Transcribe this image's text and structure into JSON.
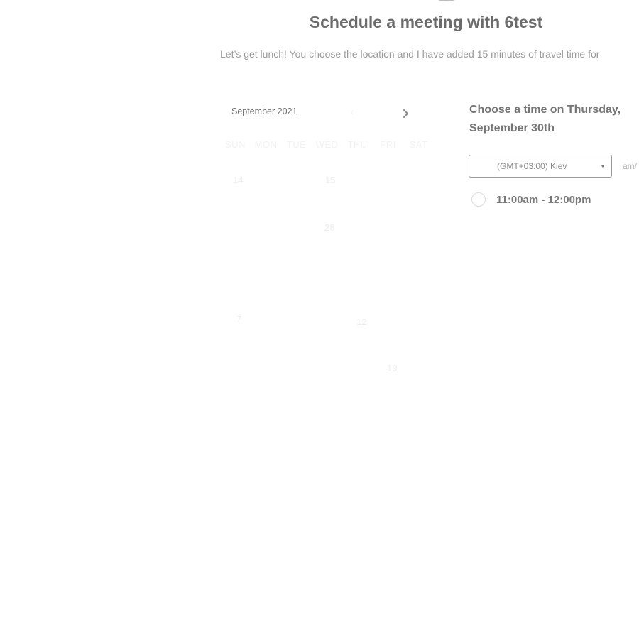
{
  "header": {
    "title": "Schedule a meeting with 6test",
    "subtitle": "Let’s get lunch! You choose the location and I have added 15 minutes of travel time for"
  },
  "calendar": {
    "month_label": "September 2021",
    "prev_icon": "chevron-left-icon",
    "next_icon": "chevron-right-icon",
    "weekdays": [
      "SUN",
      "MON",
      "TUE",
      "WED",
      "THU",
      "FRI",
      "SAT"
    ],
    "visible_days": [
      "14",
      "15",
      "28",
      "7",
      "12",
      "19"
    ]
  },
  "time_picker": {
    "heading": "Choose a time on Thursday, September 30th",
    "timezone": "(GMT+03:00) Kiev",
    "format_toggle": "am/",
    "slots": [
      {
        "label": "11:00am - 12:00pm"
      }
    ]
  },
  "colors": {
    "title": "#6b6b6b",
    "text_muted": "#9a9a9a",
    "faded": "#ededed"
  }
}
